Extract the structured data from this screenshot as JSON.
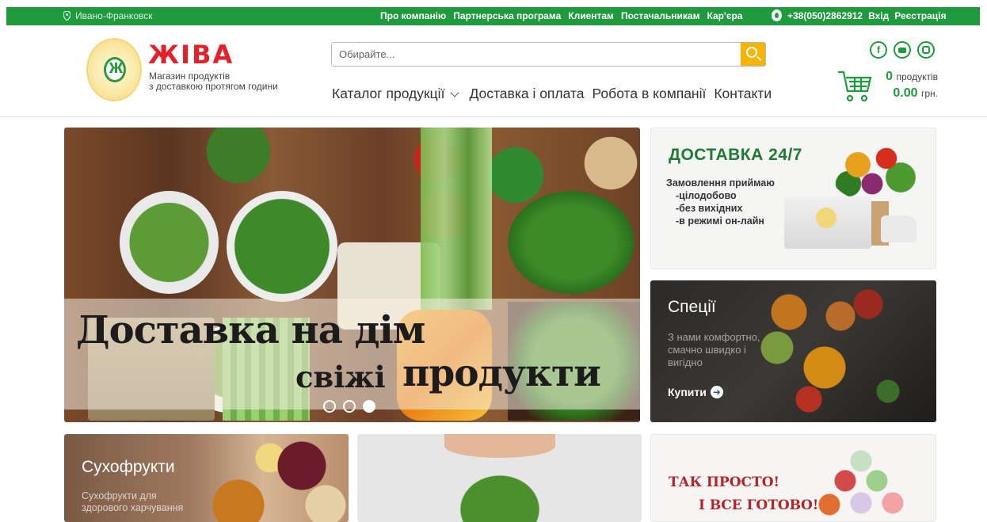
{
  "topbar": {
    "city": "Ивано-Франковск",
    "links": [
      "Про компанію",
      "Партнерська програма",
      "Клиентам",
      "Постачальникам",
      "Кар'єра"
    ],
    "phone": "+38(050)2862912",
    "login": "Вхід",
    "register": "Реєстрація"
  },
  "header": {
    "brand": "ЖІВА",
    "tagline_line1": "Магазин продуктів",
    "tagline_line2": "з доставкою протягом години",
    "search_placeholder": "Обирайте...",
    "nav": [
      "Каталог продукції",
      "Доставка і оплата",
      "Робота в компанії",
      "Контакти"
    ],
    "social_icons": [
      "facebook-icon",
      "youtube-icon",
      "instagram-icon"
    ],
    "cart": {
      "count": "0",
      "count_label": "продуктів",
      "total": "0.00",
      "currency": "грн."
    }
  },
  "hero": {
    "line1": "Доставка на дім",
    "line2a": "свіжі",
    "line2b": "продукти",
    "slides": 3,
    "active_slide": 3
  },
  "banners": {
    "delivery": {
      "title": "ДОСТАВКА 24/7",
      "lines": [
        "Замовлення приймаю",
        "-цілодобово",
        "-без вихідних",
        "-в режимі он-лайн"
      ]
    },
    "spices": {
      "title": "Спеції",
      "text": "З нами комфортно, смачно швидко і вигідно",
      "button": "Купити"
    },
    "dried": {
      "title": "Сухофрукти",
      "text_line1": "Сухофрукти для",
      "text_line2": "здорового харчування"
    },
    "ready": {
      "line1": "ТАК ПРОСТО!",
      "line2": "І ВСЕ ГОТОВО!"
    }
  },
  "colors": {
    "brand_green": "#1f9a3d",
    "brand_red": "#e4212b",
    "search_button": "#f4b400"
  }
}
